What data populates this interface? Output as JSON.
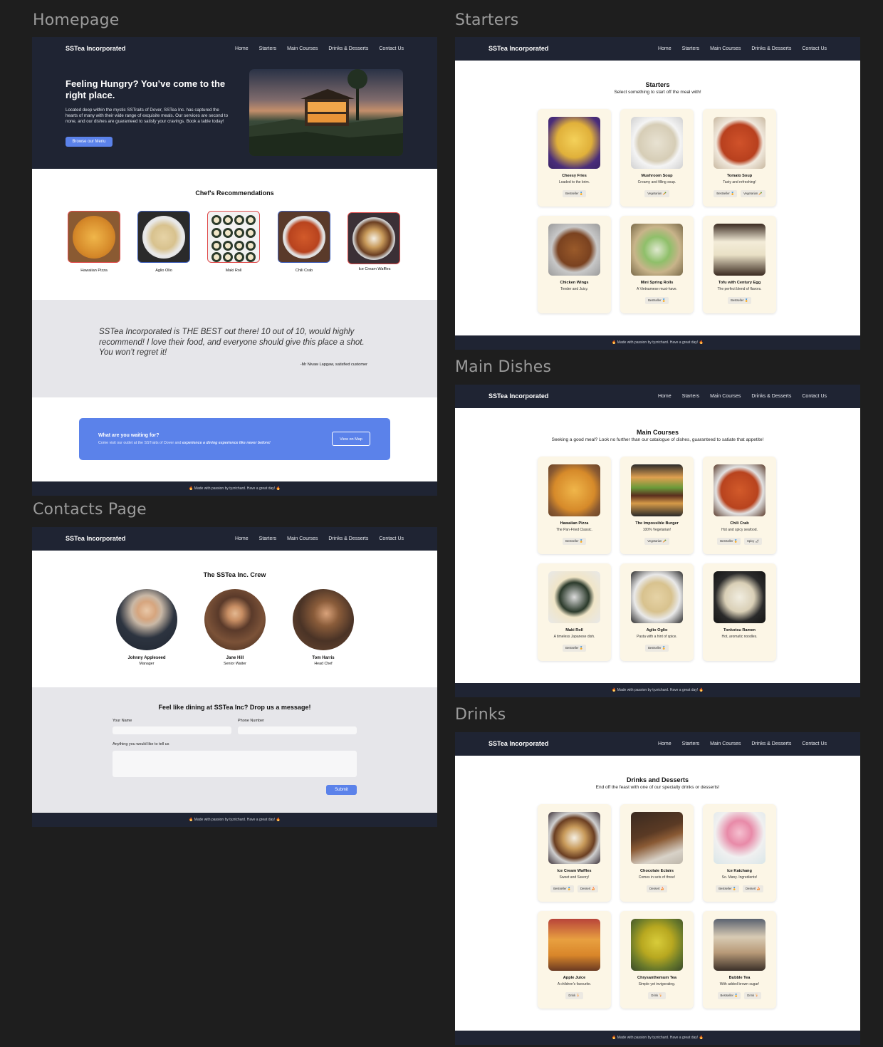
{
  "labels": {
    "homepage": "Homepage",
    "starters": "Starters",
    "main_dishes": "Main Dishes",
    "drinks": "Drinks",
    "contacts": "Contacts Page"
  },
  "nav": {
    "brand": "SSTea Incorporated",
    "links": [
      "Home",
      "Starters",
      "Main Courses",
      "Drinks & Desserts",
      "Contact Us"
    ]
  },
  "footer": "Made with passion by tyzrichard. Have a great day!",
  "home": {
    "hero_title": "Feeling Hungry? You’ve come to the right place.",
    "hero_text": "Located deep within the mystic SSTraits of Dover, SSTea Inc. has captured the hearts of many with their wide range of exquisite meals. Our services are second to none, and our dishes are guaranteed to satisfy your cravings. Book a table today!",
    "hero_button": "Browse our Menu",
    "rec_title": "Chef's Recommendations",
    "recs": [
      "Hawaiian Pizza",
      "Aglio Olio",
      "Maki Roll",
      "Chili Crab",
      "Ice Cream Waffles"
    ],
    "quote": "SSTea Incorporated is THE BEST out there! 10 out of 10, would highly recommend! I love their food, and everyone should give this place a shot. You won’t regret it!",
    "quote_author": "-Mr Nivaw Lapgaw, satisfied customer",
    "cta_title": "What are you waiting for?",
    "cta_text_1": "Come visit our outlet at the SSTraits of Dover and ",
    "cta_text_2": "experience a dining experience like never before!",
    "cta_button": "View on Map"
  },
  "contacts": {
    "title": "The SSTea Inc. Crew",
    "crew": [
      {
        "name": "Johnny Appleseed",
        "role": "Manager"
      },
      {
        "name": "Jane Hill",
        "role": "Senior Waiter"
      },
      {
        "name": "Tom Harris",
        "role": "Head Chef"
      }
    ],
    "form_title": "Feel like dining at SSTea Inc? Drop us a message!",
    "name_label": "Your Name",
    "phone_label": "Phone Number",
    "message_label": "Anything you would like to tell us",
    "submit": "Submit"
  },
  "starters": {
    "title": "Starters",
    "subtitle": "Select something to start off the meal with!",
    "items": [
      {
        "name": "Cheesy Fries",
        "desc": "Loaded to the brim.",
        "tags": [
          "Bestseller 🏅"
        ]
      },
      {
        "name": "Mushroom Soup",
        "desc": "Creamy and filling soup.",
        "tags": [
          "Vegetarian 🥕"
        ]
      },
      {
        "name": "Tomato Soup",
        "desc": "Tasty and refreshing!",
        "tags": [
          "Bestseller 🏅",
          "Vegetarian 🥕"
        ]
      },
      {
        "name": "Chicken Wings",
        "desc": "Tender and Juicy.",
        "tags": []
      },
      {
        "name": "Mini Spring Rolls",
        "desc": "A Vietnamese must-have.",
        "tags": [
          "Bestseller 🏅"
        ]
      },
      {
        "name": "Tofu with Century Egg",
        "desc": "The perfect blend of flavors.",
        "tags": [
          "Bestseller 🏅"
        ]
      }
    ]
  },
  "mains": {
    "title": "Main Courses",
    "subtitle": "Seeking a good meal? Look no further than our catalogue of dishes, guaranteed to satiate that appetite!",
    "items": [
      {
        "name": "Hawaiian Pizza",
        "desc": "The Pan-Fried Classic.",
        "tags": [
          "Bestseller 🏅"
        ]
      },
      {
        "name": "The Impossible Burger",
        "desc": "100% Vegetarian!",
        "tags": [
          "Vegetarian 🥕"
        ]
      },
      {
        "name": "Chili Crab",
        "desc": "Hot and spicy seafood.",
        "tags": [
          "Bestseller 🏅",
          "Spicy 🌶"
        ]
      },
      {
        "name": "Maki Roll",
        "desc": "A timeless Japanese dish.",
        "tags": [
          "Bestseller 🏅"
        ]
      },
      {
        "name": "Aglio Oglio",
        "desc": "Pasta with a hint of spice.",
        "tags": [
          "Bestseller 🏅"
        ]
      },
      {
        "name": "Tonkotsu Ramen",
        "desc": "Hot, aromatic noodles.",
        "tags": []
      }
    ]
  },
  "drinks": {
    "title": "Drinks and Desserts",
    "subtitle": "End off the feast with one of our specialty drinks or desserts!",
    "items": [
      {
        "name": "Ice Cream Waffles",
        "desc": "Sweet and Savory!",
        "tags": [
          "Bestseller 🏅",
          "Dessert 🍰"
        ]
      },
      {
        "name": "Chocolate Eclairs",
        "desc": "Comes in sets of three!",
        "tags": [
          "Dessert 🍰"
        ]
      },
      {
        "name": "Ice Katchang",
        "desc": "So. Many. Ingredients!",
        "tags": [
          "Bestseller 🏅",
          "Dessert 🍰"
        ]
      },
      {
        "name": "Apple Juice",
        "desc": "A children's favourite.",
        "tags": [
          "Drink 🍹"
        ]
      },
      {
        "name": "Chrysanthemum Tea",
        "desc": "Simple yet invigorating.",
        "tags": [
          "Drink 🍹"
        ]
      },
      {
        "name": "Bubble Tea",
        "desc": "With added brown sugar!",
        "tags": [
          "Bestseller 🏅",
          "Drink 🍹"
        ]
      }
    ]
  },
  "colors": {
    "nav": "#1f2433",
    "accent": "#5b82ea",
    "card": "#fcf6e6",
    "gray_section": "#e6e6ea"
  }
}
